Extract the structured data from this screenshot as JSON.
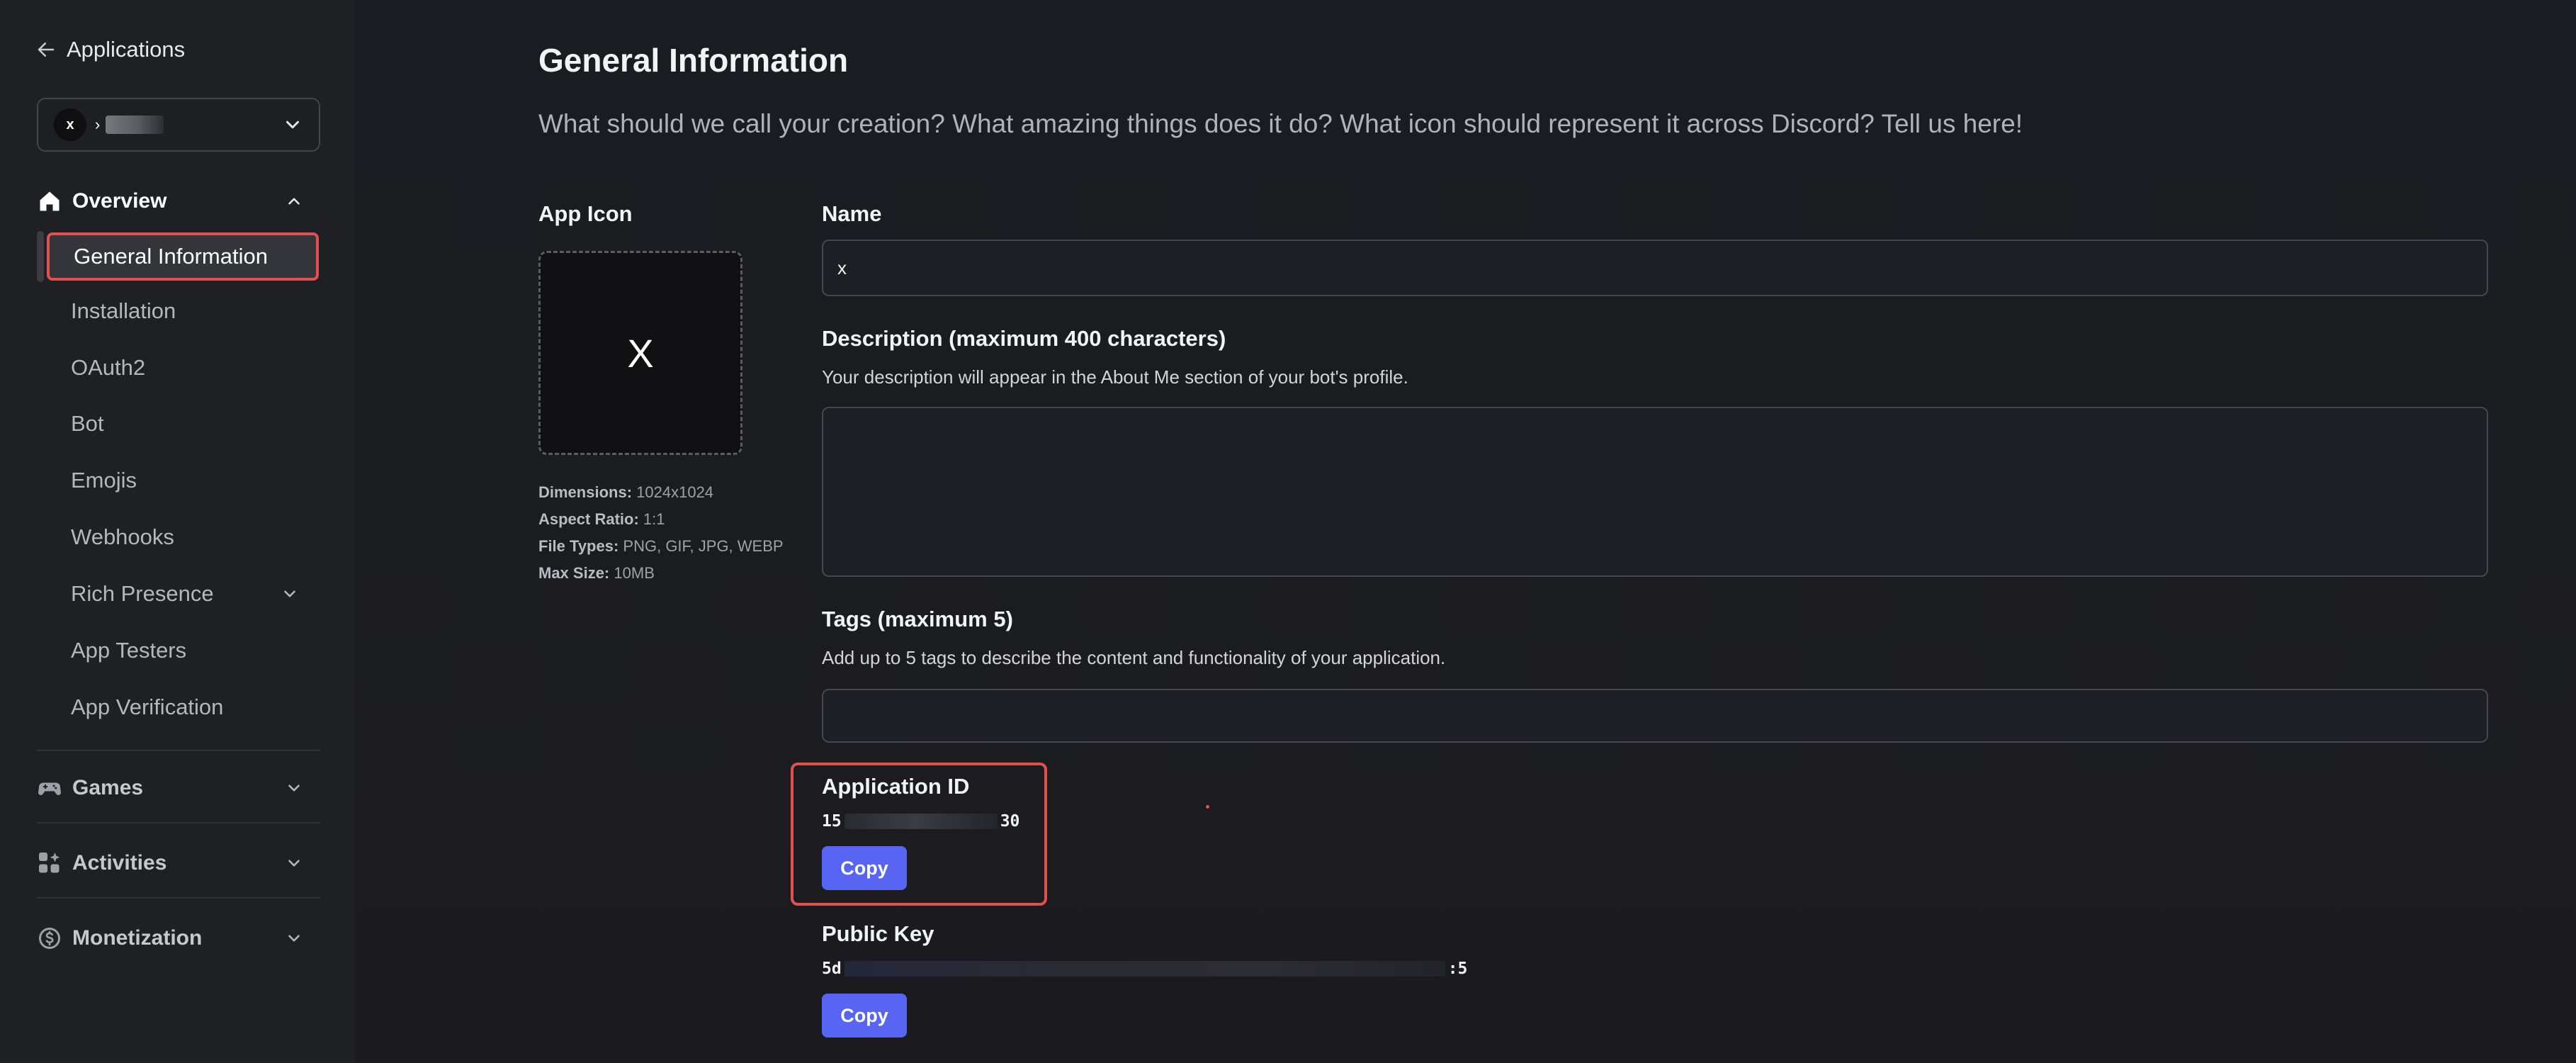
{
  "sidebar": {
    "back_label": "Applications",
    "app_selector": {
      "avatar_letter": "x",
      "name_prefix": "›"
    },
    "sections": [
      {
        "label": "Overview",
        "items": [
          "General Information",
          "Installation",
          "OAuth2",
          "Bot",
          "Emojis",
          "Webhooks",
          "Rich Presence",
          "App Testers",
          "App Verification"
        ]
      },
      {
        "label": "Games"
      },
      {
        "label": "Activities"
      },
      {
        "label": "Monetization"
      }
    ],
    "active_item": "General Information"
  },
  "main": {
    "title": "General Information",
    "subtitle": "What should we call your creation? What amazing things does it do? What icon should represent it across Discord? Tell us here!",
    "app_icon": {
      "label": "App Icon",
      "letter": "X",
      "meta": [
        {
          "key": "Dimensions:",
          "value": "1024x1024"
        },
        {
          "key": "Aspect Ratio:",
          "value": "1:1"
        },
        {
          "key": "File Types:",
          "value": "PNG, GIF, JPG, WEBP"
        },
        {
          "key": "Max Size:",
          "value": "10MB"
        }
      ]
    },
    "name": {
      "label": "Name",
      "value": "x"
    },
    "description": {
      "label": "Description (maximum 400 characters)",
      "help": "Your description will appear in the About Me section of your bot's profile.",
      "value": ""
    },
    "tags": {
      "label": "Tags (maximum 5)",
      "help": "Add up to 5 tags to describe the content and functionality of your application.",
      "value": ""
    },
    "application_id": {
      "label": "Application ID",
      "prefix": "15",
      "suffix": "30",
      "copy_label": "Copy"
    },
    "public_key": {
      "label": "Public Key",
      "prefix": "5d",
      "suffix": ":5",
      "copy_label": "Copy"
    }
  },
  "colors": {
    "accent": "#5865f2",
    "highlight": "#e0504c",
    "background": "#1b1c20"
  }
}
